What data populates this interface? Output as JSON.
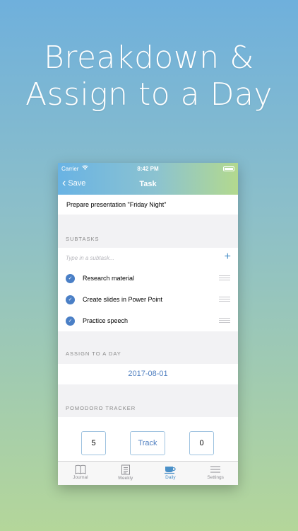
{
  "promo": {
    "headline_line1": "Breakdown &",
    "headline_line2": "Assign to a Day"
  },
  "status_bar": {
    "carrier": "Carrier",
    "time": "8:42 PM"
  },
  "nav": {
    "back_label": "Save",
    "title": "Task"
  },
  "task": {
    "title": "Prepare presentation \"Friday Night\""
  },
  "subtasks": {
    "header": "SUBTASKS",
    "placeholder": "Type in a subtask...",
    "items": [
      {
        "label": "Research material",
        "done": true
      },
      {
        "label": "Create slides in Power Point",
        "done": true
      },
      {
        "label": "Practice speech",
        "done": true
      }
    ]
  },
  "assign": {
    "header": "ASSIGN TO A DAY",
    "date": "2017-08-01"
  },
  "pomodoro": {
    "header": "POMODORO TRACKER",
    "planned": "5",
    "track_label": "Track",
    "done": "0"
  },
  "tabbar": {
    "items": [
      {
        "label": "Journal",
        "icon": "book-icon"
      },
      {
        "label": "Weekly",
        "icon": "notepad-icon"
      },
      {
        "label": "Daily",
        "icon": "coffee-cup-icon",
        "active": true
      },
      {
        "label": "Settings",
        "icon": "menu-lines-icon"
      }
    ]
  },
  "colors": {
    "accent": "#4a90c8",
    "check": "#4a7fc6"
  }
}
